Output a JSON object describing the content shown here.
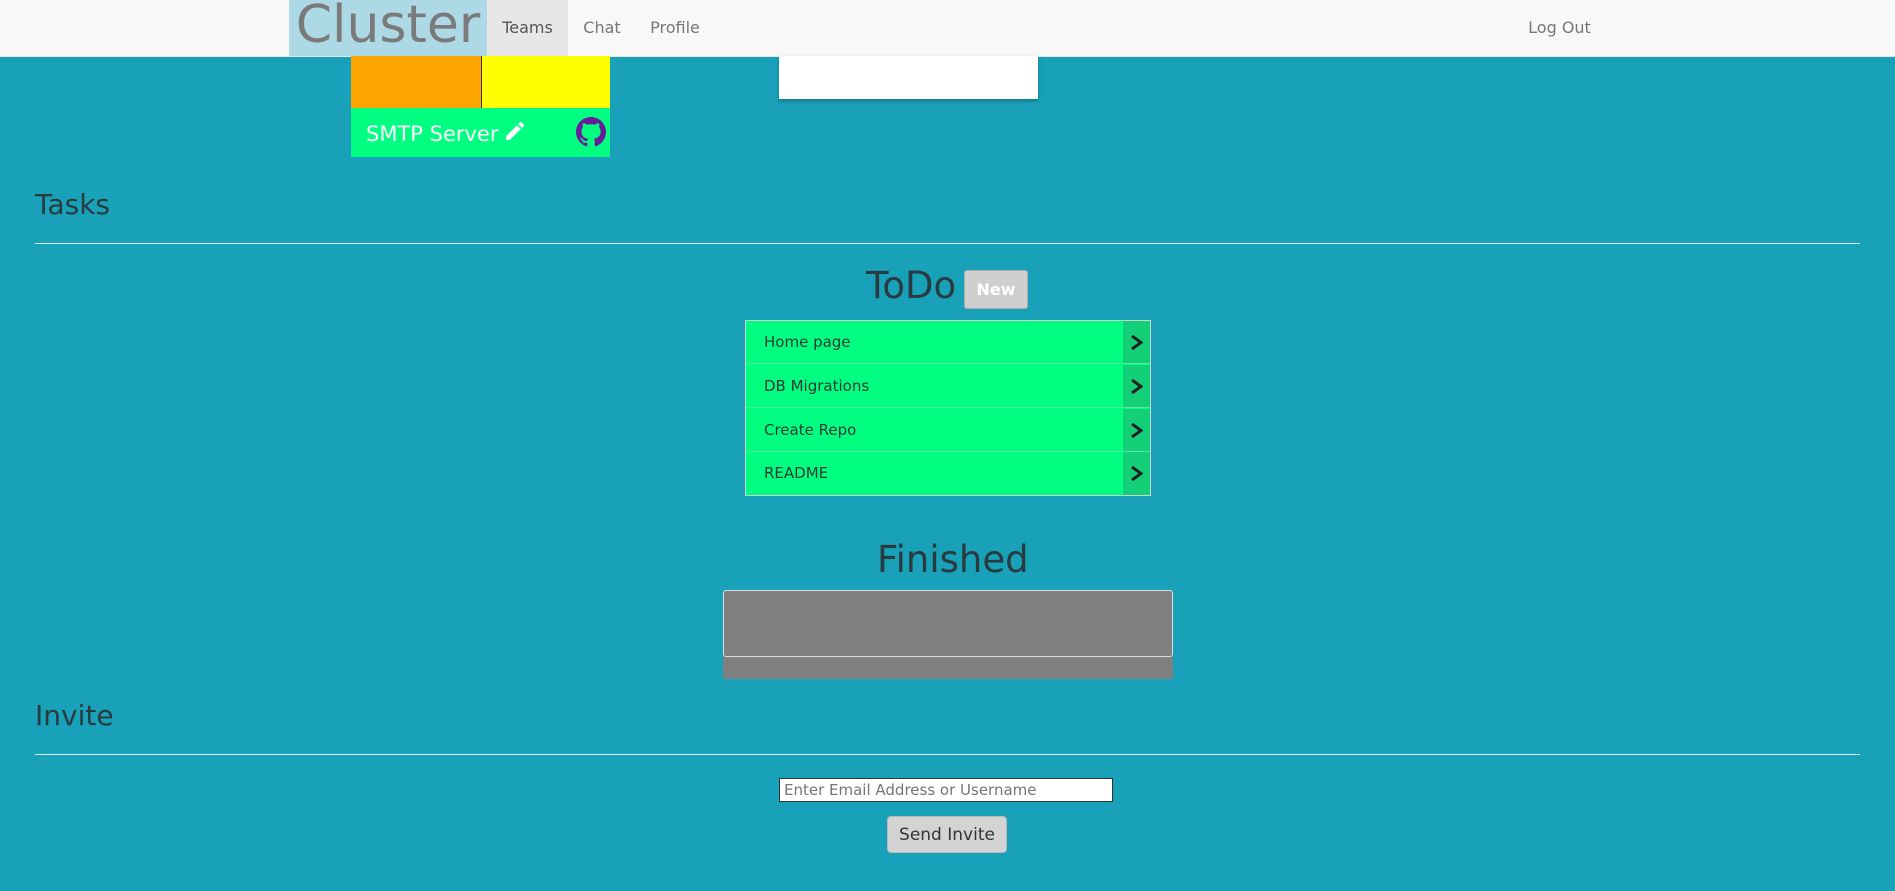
{
  "navbar": {
    "brand": "Cluster",
    "items": [
      {
        "label": "Teams",
        "active": true
      },
      {
        "label": "Chat",
        "active": false
      },
      {
        "label": "Profile",
        "active": false
      }
    ],
    "logout": "Log Out"
  },
  "project_card": {
    "title": "SMTP Server",
    "colors": [
      "#ffa500",
      "#ffff00"
    ],
    "footer_color": "#00ff80",
    "icons": [
      "pencil-icon",
      "github-icon"
    ]
  },
  "tasks": {
    "section_title": "Tasks",
    "todo": {
      "heading": "ToDo",
      "new_label": "New",
      "items": [
        "Home page",
        "DB Migrations",
        "Create Repo",
        "README"
      ]
    },
    "finished": {
      "heading": "Finished",
      "items": []
    }
  },
  "invite": {
    "section_title": "Invite",
    "placeholder": "Enter Email Address or Username",
    "value": "",
    "button_label": "Send Invite"
  },
  "colors": {
    "background": "#18a1b8",
    "brand_bg": "#add8e6",
    "todo_item": "#00ff80",
    "finished_box": "#808080"
  }
}
